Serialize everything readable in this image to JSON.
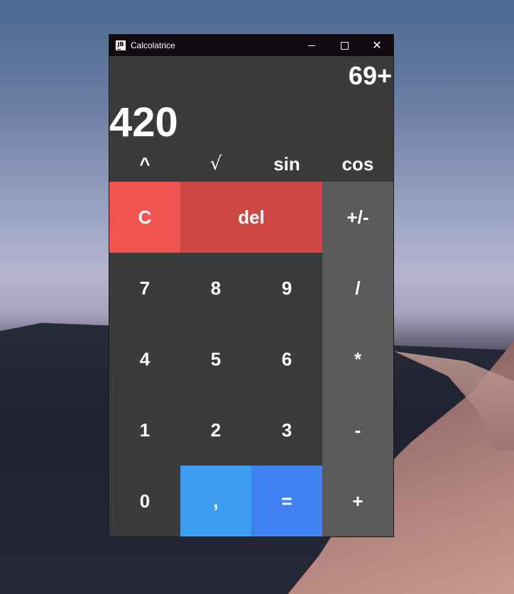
{
  "window": {
    "title": "Calcolatrice",
    "icon_label": "JB"
  },
  "display": {
    "expression": "69+",
    "result": "420"
  },
  "scientific": [
    "^",
    "√",
    "sin",
    "cos"
  ],
  "keys": {
    "clear": "C",
    "del": "del",
    "sign": "+/-",
    "seven": "7",
    "eight": "8",
    "nine": "9",
    "divide": "/",
    "four": "4",
    "five": "5",
    "six": "6",
    "multiply": "*",
    "one": "1",
    "two": "2",
    "three": "3",
    "minus": "-",
    "zero": "0",
    "comma": ",",
    "equals": "=",
    "plus": "+"
  },
  "colors": {
    "clear": "#f05450",
    "del": "#cf4745",
    "comma": "#3d9ef1",
    "equals": "#4182f3",
    "operator": "#5a5a5a",
    "background": "#3b3b3b"
  }
}
